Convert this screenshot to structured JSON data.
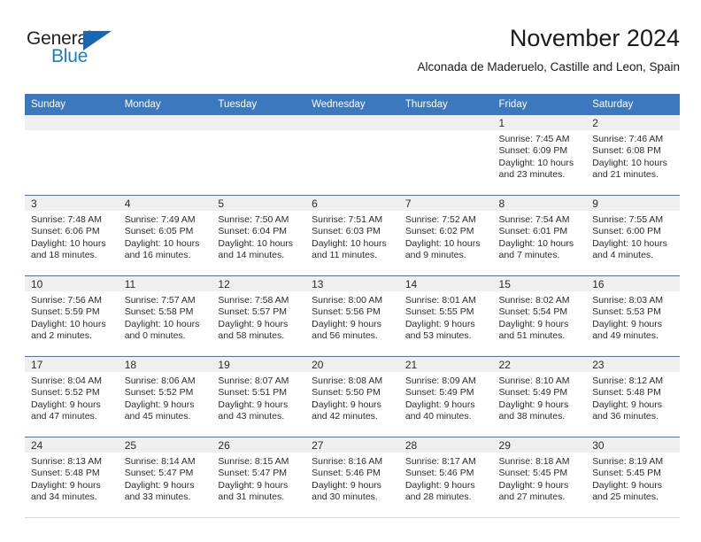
{
  "logo": {
    "word_top": "General",
    "word_bottom": "Blue",
    "triangle_color": "#1669b0",
    "blue_text_color": "#1a7ec6",
    "top_text_color": "#231f20"
  },
  "header": {
    "title": "November 2024",
    "subtitle": "Alconada de Maderuelo, Castille and Leon, Spain"
  },
  "theme": {
    "header_blue": "#3b78bd",
    "daynum_band": "#efefef",
    "text": "#2b2b2b"
  },
  "calendar": {
    "weekday_headers": [
      "Sunday",
      "Monday",
      "Tuesday",
      "Wednesday",
      "Thursday",
      "Friday",
      "Saturday"
    ],
    "weeks": [
      [
        {
          "day": "",
          "empty": true
        },
        {
          "day": "",
          "empty": true
        },
        {
          "day": "",
          "empty": true
        },
        {
          "day": "",
          "empty": true
        },
        {
          "day": "",
          "empty": true
        },
        {
          "day": "1",
          "sunrise": "Sunrise: 7:45 AM",
          "sunset": "Sunset: 6:09 PM",
          "daylight1": "Daylight: 10 hours",
          "daylight2": "and 23 minutes."
        },
        {
          "day": "2",
          "sunrise": "Sunrise: 7:46 AM",
          "sunset": "Sunset: 6:08 PM",
          "daylight1": "Daylight: 10 hours",
          "daylight2": "and 21 minutes."
        }
      ],
      [
        {
          "day": "3",
          "sunrise": "Sunrise: 7:48 AM",
          "sunset": "Sunset: 6:06 PM",
          "daylight1": "Daylight: 10 hours",
          "daylight2": "and 18 minutes."
        },
        {
          "day": "4",
          "sunrise": "Sunrise: 7:49 AM",
          "sunset": "Sunset: 6:05 PM",
          "daylight1": "Daylight: 10 hours",
          "daylight2": "and 16 minutes."
        },
        {
          "day": "5",
          "sunrise": "Sunrise: 7:50 AM",
          "sunset": "Sunset: 6:04 PM",
          "daylight1": "Daylight: 10 hours",
          "daylight2": "and 14 minutes."
        },
        {
          "day": "6",
          "sunrise": "Sunrise: 7:51 AM",
          "sunset": "Sunset: 6:03 PM",
          "daylight1": "Daylight: 10 hours",
          "daylight2": "and 11 minutes."
        },
        {
          "day": "7",
          "sunrise": "Sunrise: 7:52 AM",
          "sunset": "Sunset: 6:02 PM",
          "daylight1": "Daylight: 10 hours",
          "daylight2": "and 9 minutes."
        },
        {
          "day": "8",
          "sunrise": "Sunrise: 7:54 AM",
          "sunset": "Sunset: 6:01 PM",
          "daylight1": "Daylight: 10 hours",
          "daylight2": "and 7 minutes."
        },
        {
          "day": "9",
          "sunrise": "Sunrise: 7:55 AM",
          "sunset": "Sunset: 6:00 PM",
          "daylight1": "Daylight: 10 hours",
          "daylight2": "and 4 minutes."
        }
      ],
      [
        {
          "day": "10",
          "sunrise": "Sunrise: 7:56 AM",
          "sunset": "Sunset: 5:59 PM",
          "daylight1": "Daylight: 10 hours",
          "daylight2": "and 2 minutes."
        },
        {
          "day": "11",
          "sunrise": "Sunrise: 7:57 AM",
          "sunset": "Sunset: 5:58 PM",
          "daylight1": "Daylight: 10 hours",
          "daylight2": "and 0 minutes."
        },
        {
          "day": "12",
          "sunrise": "Sunrise: 7:58 AM",
          "sunset": "Sunset: 5:57 PM",
          "daylight1": "Daylight: 9 hours",
          "daylight2": "and 58 minutes."
        },
        {
          "day": "13",
          "sunrise": "Sunrise: 8:00 AM",
          "sunset": "Sunset: 5:56 PM",
          "daylight1": "Daylight: 9 hours",
          "daylight2": "and 56 minutes."
        },
        {
          "day": "14",
          "sunrise": "Sunrise: 8:01 AM",
          "sunset": "Sunset: 5:55 PM",
          "daylight1": "Daylight: 9 hours",
          "daylight2": "and 53 minutes."
        },
        {
          "day": "15",
          "sunrise": "Sunrise: 8:02 AM",
          "sunset": "Sunset: 5:54 PM",
          "daylight1": "Daylight: 9 hours",
          "daylight2": "and 51 minutes."
        },
        {
          "day": "16",
          "sunrise": "Sunrise: 8:03 AM",
          "sunset": "Sunset: 5:53 PM",
          "daylight1": "Daylight: 9 hours",
          "daylight2": "and 49 minutes."
        }
      ],
      [
        {
          "day": "17",
          "sunrise": "Sunrise: 8:04 AM",
          "sunset": "Sunset: 5:52 PM",
          "daylight1": "Daylight: 9 hours",
          "daylight2": "and 47 minutes."
        },
        {
          "day": "18",
          "sunrise": "Sunrise: 8:06 AM",
          "sunset": "Sunset: 5:52 PM",
          "daylight1": "Daylight: 9 hours",
          "daylight2": "and 45 minutes."
        },
        {
          "day": "19",
          "sunrise": "Sunrise: 8:07 AM",
          "sunset": "Sunset: 5:51 PM",
          "daylight1": "Daylight: 9 hours",
          "daylight2": "and 43 minutes."
        },
        {
          "day": "20",
          "sunrise": "Sunrise: 8:08 AM",
          "sunset": "Sunset: 5:50 PM",
          "daylight1": "Daylight: 9 hours",
          "daylight2": "and 42 minutes."
        },
        {
          "day": "21",
          "sunrise": "Sunrise: 8:09 AM",
          "sunset": "Sunset: 5:49 PM",
          "daylight1": "Daylight: 9 hours",
          "daylight2": "and 40 minutes."
        },
        {
          "day": "22",
          "sunrise": "Sunrise: 8:10 AM",
          "sunset": "Sunset: 5:49 PM",
          "daylight1": "Daylight: 9 hours",
          "daylight2": "and 38 minutes."
        },
        {
          "day": "23",
          "sunrise": "Sunrise: 8:12 AM",
          "sunset": "Sunset: 5:48 PM",
          "daylight1": "Daylight: 9 hours",
          "daylight2": "and 36 minutes."
        }
      ],
      [
        {
          "day": "24",
          "sunrise": "Sunrise: 8:13 AM",
          "sunset": "Sunset: 5:48 PM",
          "daylight1": "Daylight: 9 hours",
          "daylight2": "and 34 minutes."
        },
        {
          "day": "25",
          "sunrise": "Sunrise: 8:14 AM",
          "sunset": "Sunset: 5:47 PM",
          "daylight1": "Daylight: 9 hours",
          "daylight2": "and 33 minutes."
        },
        {
          "day": "26",
          "sunrise": "Sunrise: 8:15 AM",
          "sunset": "Sunset: 5:47 PM",
          "daylight1": "Daylight: 9 hours",
          "daylight2": "and 31 minutes."
        },
        {
          "day": "27",
          "sunrise": "Sunrise: 8:16 AM",
          "sunset": "Sunset: 5:46 PM",
          "daylight1": "Daylight: 9 hours",
          "daylight2": "and 30 minutes."
        },
        {
          "day": "28",
          "sunrise": "Sunrise: 8:17 AM",
          "sunset": "Sunset: 5:46 PM",
          "daylight1": "Daylight: 9 hours",
          "daylight2": "and 28 minutes."
        },
        {
          "day": "29",
          "sunrise": "Sunrise: 8:18 AM",
          "sunset": "Sunset: 5:45 PM",
          "daylight1": "Daylight: 9 hours",
          "daylight2": "and 27 minutes."
        },
        {
          "day": "30",
          "sunrise": "Sunrise: 8:19 AM",
          "sunset": "Sunset: 5:45 PM",
          "daylight1": "Daylight: 9 hours",
          "daylight2": "and 25 minutes."
        }
      ]
    ]
  }
}
